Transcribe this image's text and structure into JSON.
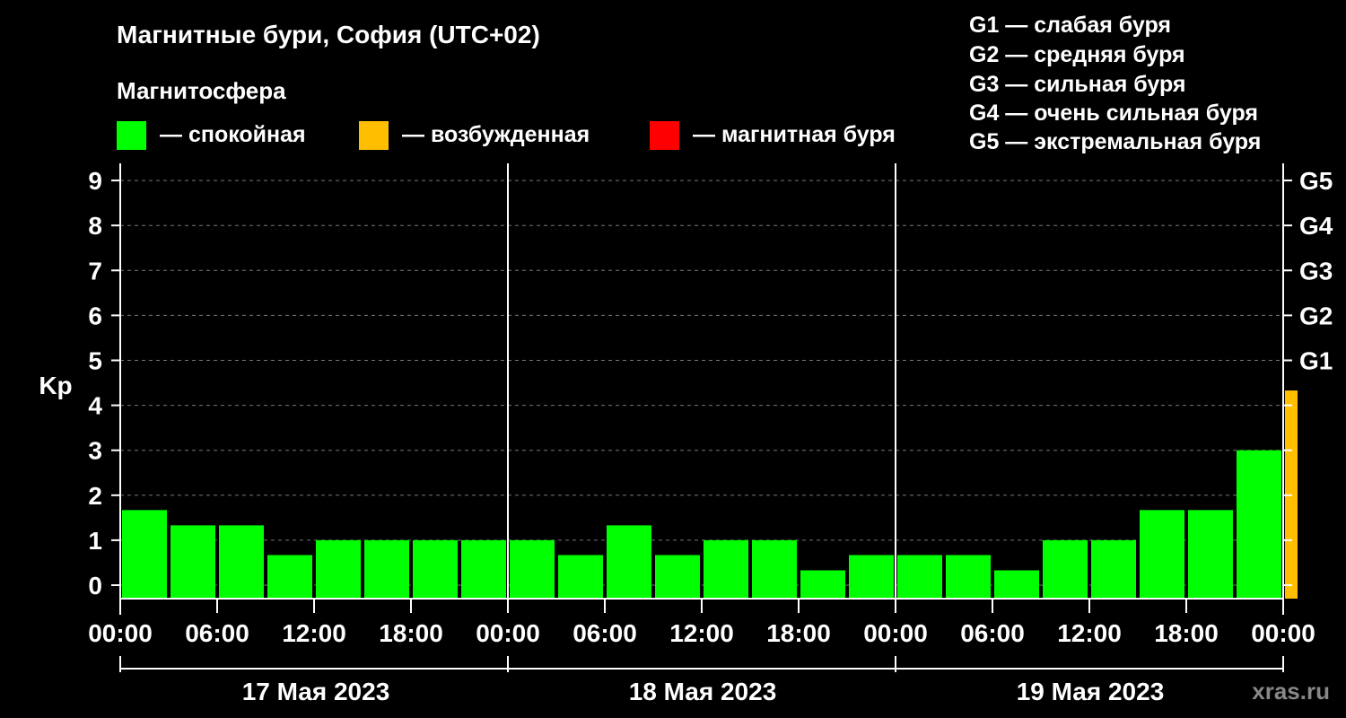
{
  "chart_data": {
    "type": "bar",
    "title": "Магнитные бури, София (UTC+02)",
    "legend_title": "Магнитосфера",
    "legend": [
      {
        "label": "— спокойная",
        "color": "#00ff00"
      },
      {
        "label": "— возбужденная",
        "color": "#ffbf00"
      },
      {
        "label": "— магнитная буря",
        "color": "#ff0000"
      }
    ],
    "storm_scale": [
      "G1 — слабая буря",
      "G2 — средняя буря",
      "G3 — сильная буря",
      "G4 — очень сильная буря",
      "G5 — экстремальная буря"
    ],
    "ylabel": "Kp",
    "ylim": [
      0,
      9
    ],
    "yticks": [
      "0",
      "1",
      "2",
      "3",
      "4",
      "5",
      "6",
      "7",
      "8",
      "9"
    ],
    "right_ticks": [
      {
        "label": "G1",
        "kp": 5
      },
      {
        "label": "G2",
        "kp": 6
      },
      {
        "label": "G3",
        "kp": 7
      },
      {
        "label": "G4",
        "kp": 8
      },
      {
        "label": "G5",
        "kp": 9
      }
    ],
    "xtick_labels": [
      "00:00",
      "06:00",
      "12:00",
      "18:00",
      "00:00",
      "06:00",
      "12:00",
      "18:00",
      "00:00",
      "06:00",
      "12:00",
      "18:00",
      "00:00"
    ],
    "dates": [
      "17 Мая 2023",
      "18 Мая 2023",
      "19 Мая 2023"
    ],
    "bars": [
      {
        "start_hour": 0,
        "end_hour": 3,
        "kp": 1.67,
        "status": "calm"
      },
      {
        "start_hour": 3,
        "end_hour": 6,
        "kp": 1.33,
        "status": "calm"
      },
      {
        "start_hour": 6,
        "end_hour": 9,
        "kp": 1.33,
        "status": "calm"
      },
      {
        "start_hour": 9,
        "end_hour": 12,
        "kp": 0.67,
        "status": "calm"
      },
      {
        "start_hour": 12,
        "end_hour": 15,
        "kp": 1.0,
        "status": "calm"
      },
      {
        "start_hour": 15,
        "end_hour": 18,
        "kp": 1.0,
        "status": "calm"
      },
      {
        "start_hour": 18,
        "end_hour": 21,
        "kp": 1.0,
        "status": "calm"
      },
      {
        "start_hour": 21,
        "end_hour": 24,
        "kp": 1.0,
        "status": "calm"
      },
      {
        "start_hour": 24,
        "end_hour": 27,
        "kp": 1.0,
        "status": "calm"
      },
      {
        "start_hour": 27,
        "end_hour": 30,
        "kp": 0.67,
        "status": "calm"
      },
      {
        "start_hour": 30,
        "end_hour": 33,
        "kp": 1.33,
        "status": "calm"
      },
      {
        "start_hour": 33,
        "end_hour": 36,
        "kp": 0.67,
        "status": "calm"
      },
      {
        "start_hour": 36,
        "end_hour": 39,
        "kp": 1.0,
        "status": "calm"
      },
      {
        "start_hour": 39,
        "end_hour": 42,
        "kp": 1.0,
        "status": "calm"
      },
      {
        "start_hour": 42,
        "end_hour": 45,
        "kp": 0.33,
        "status": "calm"
      },
      {
        "start_hour": 45,
        "end_hour": 48,
        "kp": 0.67,
        "status": "calm"
      },
      {
        "start_hour": 48,
        "end_hour": 51,
        "kp": 0.67,
        "status": "calm"
      },
      {
        "start_hour": 51,
        "end_hour": 54,
        "kp": 0.67,
        "status": "calm"
      },
      {
        "start_hour": 54,
        "end_hour": 57,
        "kp": 0.33,
        "status": "calm"
      },
      {
        "start_hour": 57,
        "end_hour": 60,
        "kp": 1.0,
        "status": "calm"
      },
      {
        "start_hour": 60,
        "end_hour": 63,
        "kp": 1.0,
        "status": "calm"
      },
      {
        "start_hour": 63,
        "end_hour": 66,
        "kp": 1.67,
        "status": "calm"
      },
      {
        "start_hour": 66,
        "end_hour": 69,
        "kp": 1.67,
        "status": "calm"
      },
      {
        "start_hour": 69,
        "end_hour": 72,
        "kp": 3.0,
        "status": "calm"
      },
      {
        "start_hour": 72,
        "end_hour": 73,
        "kp": 4.33,
        "status": "active"
      }
    ],
    "status_colors": {
      "calm": "#00ff00",
      "active": "#ffbf00",
      "storm": "#ff0000"
    },
    "grid": true,
    "watermark": "xras.ru"
  }
}
